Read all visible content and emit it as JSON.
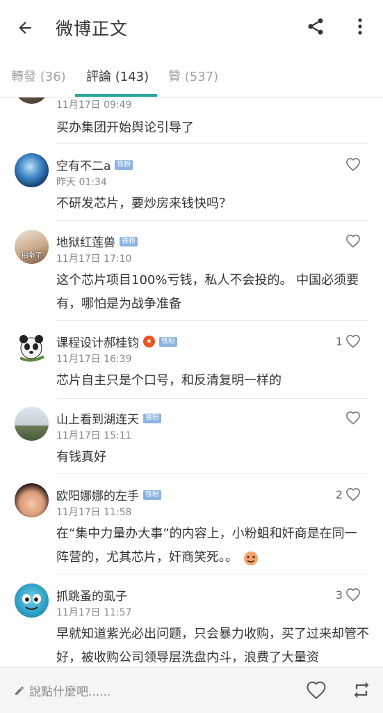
{
  "header": {
    "title": "微博正文"
  },
  "tabs": [
    {
      "label": "轉發 (36)"
    },
    {
      "label": "評論 (143)"
    },
    {
      "label": "贊 (537)"
    }
  ],
  "comments": [
    {
      "name": "",
      "badge": "",
      "time": "11月17日 09:49",
      "text": "买办集团开始舆论引导了",
      "likes": ""
    },
    {
      "name": "空有不二a",
      "badge": "铁粉",
      "time": "昨天 01:34",
      "text": "不研发芯片，要炒房来钱快吗？",
      "likes": ""
    },
    {
      "name": "地狱红莲兽",
      "badge": "铁粉",
      "time": "11月17日 17:10",
      "text": "这个芯片项目100%亏钱，私人不会投的。 中国必须要有，哪怕是为战争准备",
      "likes": "",
      "avatar_text": "拍拳了"
    },
    {
      "name": "课程设计郝桂钧",
      "badge": "铁粉",
      "time": "11月17日 16:39",
      "text": "芯片自主只是个口号，和反清复明一样的",
      "likes": "1"
    },
    {
      "name": "山上看到湖连天",
      "badge": "铁粉",
      "time": "11月17日 15:11",
      "text": "有钱真好",
      "likes": ""
    },
    {
      "name": "欧阳娜娜的左手",
      "badge": "铁粉",
      "time": "11月17日 11:58",
      "text": "在“集中力量办大事”的内容上，小粉蛆和奸商是在同一阵营的，尤其芯片，奸商笑死。。",
      "likes": "2"
    },
    {
      "name": "抓跳蚤的虱子",
      "badge": "",
      "time": "11月17日 11:57",
      "text": "早就知道紫光必出问题，只会暴力收购，买了过来却管不好，被收购公司领导层洗盘内斗，浪费了大量资",
      "likes": "3"
    }
  ],
  "bottom": {
    "reply_placeholder": "說點什麼吧......"
  },
  "colors": {
    "accent": "#2aa89c",
    "badge": "#8cb3e0",
    "vip": "#e8541e"
  },
  "icons": {
    "back": "arrow-left-icon",
    "share": "share-icon",
    "more": "more-vertical-icon",
    "like": "heart-icon",
    "reply": "pencil-icon",
    "repost": "repost-icon"
  }
}
